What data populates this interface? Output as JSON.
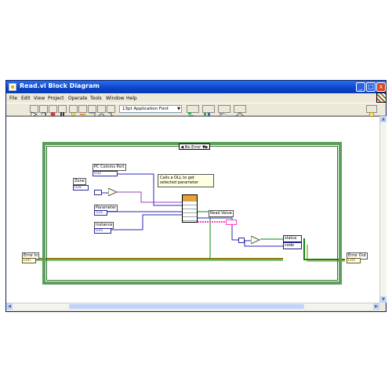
{
  "window": {
    "title": "Read.vi Block Diagram",
    "minimize": "_",
    "maximize": "□",
    "close": "x"
  },
  "menu": [
    "File",
    "Edit",
    "View",
    "Project",
    "Operate",
    "Tools",
    "Window",
    "Help"
  ],
  "toolbar": {
    "font_select": "13pt Application Font"
  },
  "diagram": {
    "case_selector": "No Error",
    "controls": {
      "pc_comms_port": "PC Comms Port",
      "zone": "Zone",
      "parameter": "Parameter",
      "instance": "Instance",
      "error_in": "Error In",
      "error_out": "Error Out",
      "read_value": "Read Value",
      "status": "status",
      "code": "code"
    },
    "terminal_types": {
      "u32": "U32",
      "i32": "I32",
      "u16": "U16",
      "err": "ERR"
    },
    "comment": "Calls a DLL to get selected parameter",
    "wire_colors": {
      "blue": "#2a2ab8",
      "numeric_violet": "#9040c0",
      "pink": "#ff40c0",
      "green": "#0a8a0a",
      "olive_error": "#8a7a00"
    }
  }
}
